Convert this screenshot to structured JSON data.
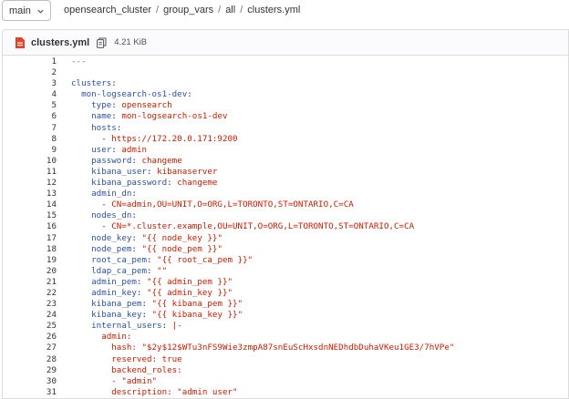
{
  "branch": {
    "label": "main"
  },
  "breadcrumb": [
    "opensearch_cluster",
    "group_vars",
    "all",
    "clusters.yml"
  ],
  "file": {
    "name": "clusters.yml",
    "size": "4.21 KiB"
  },
  "code_lines": [
    [
      {
        "t": "---",
        "c": "c"
      }
    ],
    [],
    [
      {
        "t": "clusters",
        "c": "k"
      },
      {
        "t": ":",
        "c": "txt"
      }
    ],
    [
      {
        "t": "  mon-logsearch-os1-dev",
        "c": "k"
      },
      {
        "t": ":",
        "c": "txt"
      }
    ],
    [
      {
        "t": "    type",
        "c": "k"
      },
      {
        "t": ": ",
        "c": "txt"
      },
      {
        "t": "opensearch",
        "c": "v"
      }
    ],
    [
      {
        "t": "    name",
        "c": "k"
      },
      {
        "t": ": ",
        "c": "txt"
      },
      {
        "t": "mon-logsearch-os1-dev",
        "c": "v"
      }
    ],
    [
      {
        "t": "    hosts",
        "c": "k"
      },
      {
        "t": ":",
        "c": "txt"
      }
    ],
    [
      {
        "t": "      - ",
        "c": "txt"
      },
      {
        "t": "https://172.20.0.171:9200",
        "c": "v"
      }
    ],
    [
      {
        "t": "    user",
        "c": "k"
      },
      {
        "t": ": ",
        "c": "txt"
      },
      {
        "t": "admin",
        "c": "v"
      }
    ],
    [
      {
        "t": "    password",
        "c": "k"
      },
      {
        "t": ": ",
        "c": "txt"
      },
      {
        "t": "changeme",
        "c": "v"
      }
    ],
    [
      {
        "t": "    kibana_user",
        "c": "k"
      },
      {
        "t": ": ",
        "c": "txt"
      },
      {
        "t": "kibanaserver",
        "c": "v"
      }
    ],
    [
      {
        "t": "    kibana_password",
        "c": "k"
      },
      {
        "t": ": ",
        "c": "txt"
      },
      {
        "t": "changeme",
        "c": "v"
      }
    ],
    [
      {
        "t": "    admin_dn",
        "c": "k"
      },
      {
        "t": ":",
        "c": "txt"
      }
    ],
    [
      {
        "t": "      - ",
        "c": "txt"
      },
      {
        "t": "CN=admin,OU=UNIT,O=ORG,L=TORONTO,ST=ONTARIO,C=CA",
        "c": "v"
      }
    ],
    [
      {
        "t": "    nodes_dn",
        "c": "k"
      },
      {
        "t": ":",
        "c": "txt"
      }
    ],
    [
      {
        "t": "      - ",
        "c": "txt"
      },
      {
        "t": "CN=*.cluster.example,OU=UNIT,O=ORG,L=TORONTO,ST=ONTARIO,C=CA",
        "c": "v"
      }
    ],
    [
      {
        "t": "    node_key",
        "c": "k"
      },
      {
        "t": ": ",
        "c": "txt"
      },
      {
        "t": "\"{{ node_key }}\"",
        "c": "v"
      }
    ],
    [
      {
        "t": "    node_pem",
        "c": "k"
      },
      {
        "t": ": ",
        "c": "txt"
      },
      {
        "t": "\"{{ node_pem }}\"",
        "c": "v"
      }
    ],
    [
      {
        "t": "    root_ca_pem",
        "c": "k"
      },
      {
        "t": ": ",
        "c": "txt"
      },
      {
        "t": "\"{{ root_ca_pem }}\"",
        "c": "v"
      }
    ],
    [
      {
        "t": "    ldap_ca_pem",
        "c": "k"
      },
      {
        "t": ": ",
        "c": "txt"
      },
      {
        "t": "\"\"",
        "c": "v"
      }
    ],
    [
      {
        "t": "    admin_pem",
        "c": "k"
      },
      {
        "t": ": ",
        "c": "txt"
      },
      {
        "t": "\"{{ admin_pem }}\"",
        "c": "v"
      }
    ],
    [
      {
        "t": "    admin_key",
        "c": "k"
      },
      {
        "t": ": ",
        "c": "txt"
      },
      {
        "t": "\"{{ admin_key }}\"",
        "c": "v"
      }
    ],
    [
      {
        "t": "    kibana_pem",
        "c": "k"
      },
      {
        "t": ": ",
        "c": "txt"
      },
      {
        "t": "\"{{ kibana_pem }}\"",
        "c": "v"
      }
    ],
    [
      {
        "t": "    kibana_key",
        "c": "k"
      },
      {
        "t": ": ",
        "c": "txt"
      },
      {
        "t": "\"{{ kibana_key }}\"",
        "c": "v"
      }
    ],
    [
      {
        "t": "    internal_users",
        "c": "k"
      },
      {
        "t": ": ",
        "c": "txt"
      },
      {
        "t": "|-",
        "c": "v"
      }
    ],
    [
      {
        "t": "      admin",
        "c": "v"
      },
      {
        "t": ":",
        "c": "v"
      }
    ],
    [
      {
        "t": "        hash: \"$2y$12$WTu3nFS9Wie3zmpA87snEuScHxsdnNEDhdbDuhaVKeu1GE3/7hVPe\"",
        "c": "v"
      }
    ],
    [
      {
        "t": "        reserved: true",
        "c": "v"
      }
    ],
    [
      {
        "t": "        backend_roles:",
        "c": "v"
      }
    ],
    [
      {
        "t": "        - \"admin\"",
        "c": "v"
      }
    ],
    [
      {
        "t": "        description: \"admin user\"",
        "c": "v"
      }
    ]
  ]
}
